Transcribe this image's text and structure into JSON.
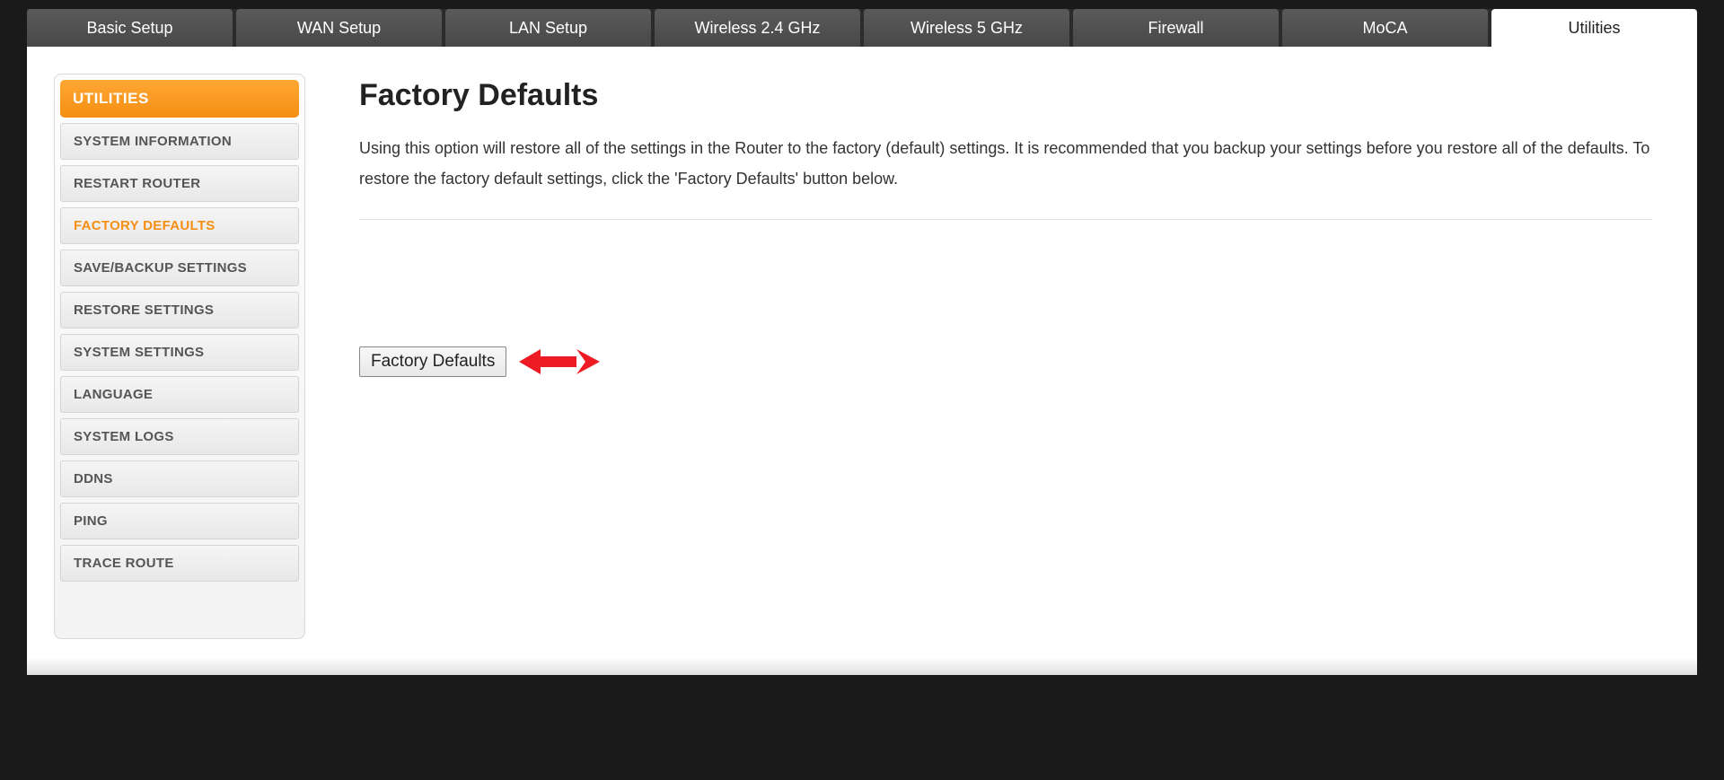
{
  "tabs": [
    {
      "label": "Basic Setup",
      "active": false
    },
    {
      "label": "WAN Setup",
      "active": false
    },
    {
      "label": "LAN Setup",
      "active": false
    },
    {
      "label": "Wireless 2.4 GHz",
      "active": false
    },
    {
      "label": "Wireless 5 GHz",
      "active": false
    },
    {
      "label": "Firewall",
      "active": false
    },
    {
      "label": "MoCA",
      "active": false
    },
    {
      "label": "Utilities",
      "active": true
    }
  ],
  "sidebar": {
    "header": "UTILITIES",
    "items": [
      {
        "label": "SYSTEM INFORMATION",
        "active": false
      },
      {
        "label": "RESTART ROUTER",
        "active": false
      },
      {
        "label": "FACTORY DEFAULTS",
        "active": true
      },
      {
        "label": "SAVE/BACKUP SETTINGS",
        "active": false
      },
      {
        "label": "RESTORE SETTINGS",
        "active": false
      },
      {
        "label": "SYSTEM SETTINGS",
        "active": false
      },
      {
        "label": "LANGUAGE",
        "active": false
      },
      {
        "label": "SYSTEM LOGS",
        "active": false
      },
      {
        "label": "DDNS",
        "active": false
      },
      {
        "label": "PING",
        "active": false
      },
      {
        "label": "TRACE ROUTE",
        "active": false
      }
    ]
  },
  "main": {
    "title": "Factory Defaults",
    "description": "Using this option will restore all of the settings in the Router to the factory (default) settings. It is recommended that you backup your settings before you restore all of the defaults. To restore the factory default settings, click the 'Factory Defaults' button below.",
    "button_label": "Factory Defaults"
  },
  "colors": {
    "accent": "#f58f13",
    "annotation": "#ed1c24"
  }
}
